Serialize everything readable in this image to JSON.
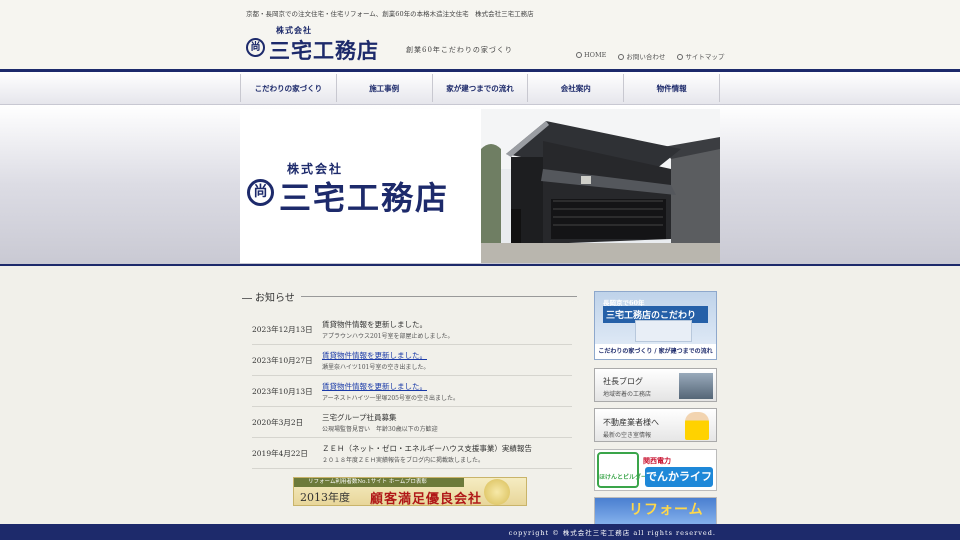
{
  "header": {
    "tagline": "京都・長岡京での注文住宅・住宅リフォーム、創業60年の本格木造注文住宅　株式会社三宅工務店",
    "logo_sub": "株式会社",
    "logo_mark": "尚",
    "logo_main": "三宅工務店",
    "catchcopy": "創業60年こだわりの家づくり",
    "links": [
      "HOME",
      "お問い合わせ",
      "サイトマップ"
    ]
  },
  "nav": {
    "items": [
      "こだわりの家づくり",
      "施工事例",
      "家が建つまでの流れ",
      "会社案内",
      "物件情報"
    ]
  },
  "hero": {
    "sub": "株式会社",
    "mark": "尚",
    "main": "三宅工務店"
  },
  "news": {
    "title": "お知らせ",
    "items": [
      {
        "date": "2023年12月13日",
        "headline": "賃貸物件情報を更新しました。",
        "desc": "アプラウンハウス201号室を部屋止めしました。",
        "link": false
      },
      {
        "date": "2023年10月27日",
        "headline": "賃貸物件情報を更新しました。",
        "desc": "瀬里奈ハイツ101号室の空き出ました。",
        "link": true
      },
      {
        "date": "2023年10月13日",
        "headline": "賃貸物件情報を更新しました。",
        "desc": "アーネストハイツ一里塚205号室の空き出ました。",
        "link": true
      },
      {
        "date": "2020年3月2日",
        "headline": "三宅グループ社員募集",
        "desc": "公現場監督見習い　年齢30歳以下の方歓迎",
        "link": false
      },
      {
        "date": "2019年4月22日",
        "headline": "ＺＥＨ（ネット・ゼロ・エネルギーハウス支援事業）実績報告",
        "desc": "２０１８年度ＺＥＨ実績報告をブログ内に掲載致しました。",
        "link": false
      }
    ]
  },
  "award": {
    "top": "リフォーム利用者数No.1サイト ホームプロ表彰",
    "year": "2013年度",
    "main": "顧客満足優良会社"
  },
  "sidebar": {
    "banner1": {
      "line1": "長岡京で60年",
      "line2": "三宅工務店のこだわり",
      "line3": "こだわりの家づくり / 家が建つまでの流れ"
    },
    "banner2": {
      "title": "社長ブログ",
      "sub": "地域密着の工務店"
    },
    "banner3": {
      "title": "不動産業者様へ",
      "sub": "最新の空き室情報"
    },
    "banner4": {
      "left": "ほけんとビルダー会",
      "brand": "関西電力",
      "main": "でんかライフ"
    },
    "banner5": {
      "main": "リフォーム"
    }
  },
  "footer": {
    "copyright": "copyright © 株式会社三宅工務店 all rights reserved."
  },
  "colors": {
    "brand": "#1d2a6b",
    "link": "#1a3aa8"
  }
}
